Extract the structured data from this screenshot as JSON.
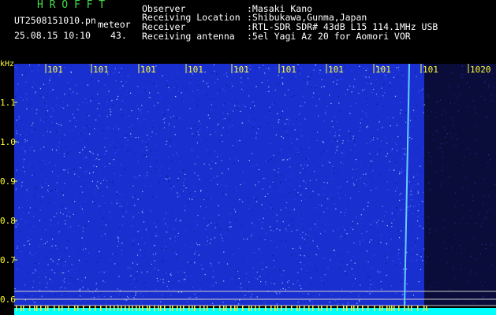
{
  "header": {
    "logo": "H R O F F T",
    "filename": "UT2508151010.pn",
    "tag": "meteor",
    "datetime": "25.08.15 10:10",
    "count": "43.",
    "info": [
      {
        "label": "Observer",
        "value": ":Masaki Kano"
      },
      {
        "label": "Receiving Location",
        "value": ":Shibukawa,Gunma,Japan"
      },
      {
        "label": "Receiver",
        "value": ":RTL-SDR SDR# 43dB L15 114.1MHz USB"
      },
      {
        "label": "Receiving antenna",
        "value": ":5el Yagi Az 20 for Aomori VOR"
      }
    ]
  },
  "axis": {
    "unit": "kHz",
    "y_ticks": [
      "1.1",
      "1.0",
      "0.9",
      "0.8",
      "0.7",
      "0.6"
    ],
    "time_ticks": [
      "101",
      "101",
      "101",
      "101",
      "101",
      "101",
      "101",
      "101",
      "101",
      "1020"
    ]
  },
  "colors": {
    "background": "#000000",
    "noise": "#1a2fd0",
    "signal": "#00ffff",
    "text": "#ffffff",
    "ticks": "#ffff33",
    "logo": "#44dd44"
  }
}
